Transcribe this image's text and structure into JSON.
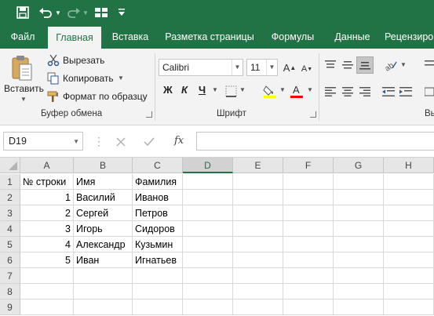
{
  "qat": {
    "icons": [
      "save-icon",
      "undo-icon",
      "redo-icon",
      "form-icon",
      "customize-icon"
    ]
  },
  "tabs": [
    {
      "label": "Файл"
    },
    {
      "label": "Главная"
    },
    {
      "label": "Вставка"
    },
    {
      "label": "Разметка страницы"
    },
    {
      "label": "Формулы"
    },
    {
      "label": "Данные"
    },
    {
      "label": "Рецензиро"
    }
  ],
  "ribbon": {
    "clipboard": {
      "paste_label": "Вставить",
      "cut_label": "Вырезать",
      "copy_label": "Копировать",
      "format_painter_label": "Формат по образцу",
      "group_label": "Буфер обмена"
    },
    "font": {
      "font_name": "Calibri",
      "font_size": "11",
      "bold_label": "Ж",
      "italic_label": "К",
      "underline_label": "Ч",
      "group_label": "Шрифт"
    },
    "alignment": {
      "group_label_partial": "Вы"
    },
    "colors": {
      "accent": "#217346",
      "fill_color": "#ffff00",
      "font_color": "#ff0000"
    }
  },
  "formula_bar": {
    "name_box": "D19",
    "fx_label": "fx",
    "formula": ""
  },
  "sheet": {
    "columns": [
      "A",
      "B",
      "C",
      "D",
      "E",
      "F",
      "G",
      "H"
    ],
    "selected_column": "D",
    "row_numbers": [
      "1",
      "2",
      "3",
      "4",
      "5",
      "6",
      "7",
      "8",
      "9"
    ],
    "rows": [
      [
        "№ строки",
        "Имя",
        "Фамилия",
        "",
        "",
        "",
        "",
        ""
      ],
      [
        "1",
        "Василий",
        "Иванов",
        "",
        "",
        "",
        "",
        ""
      ],
      [
        "2",
        "Сергей",
        "Петров",
        "",
        "",
        "",
        "",
        ""
      ],
      [
        "3",
        "Игорь",
        "Сидоров",
        "",
        "",
        "",
        "",
        ""
      ],
      [
        "4",
        "Александр",
        "Кузьмин",
        "",
        "",
        "",
        "",
        ""
      ],
      [
        "5",
        "Иван",
        "Игнатьев",
        "",
        "",
        "",
        "",
        ""
      ],
      [
        "",
        "",
        "",
        "",
        "",
        "",
        "",
        ""
      ],
      [
        "",
        "",
        "",
        "",
        "",
        "",
        "",
        ""
      ],
      [
        "",
        "",
        "",
        "",
        "",
        "",
        "",
        ""
      ]
    ]
  }
}
